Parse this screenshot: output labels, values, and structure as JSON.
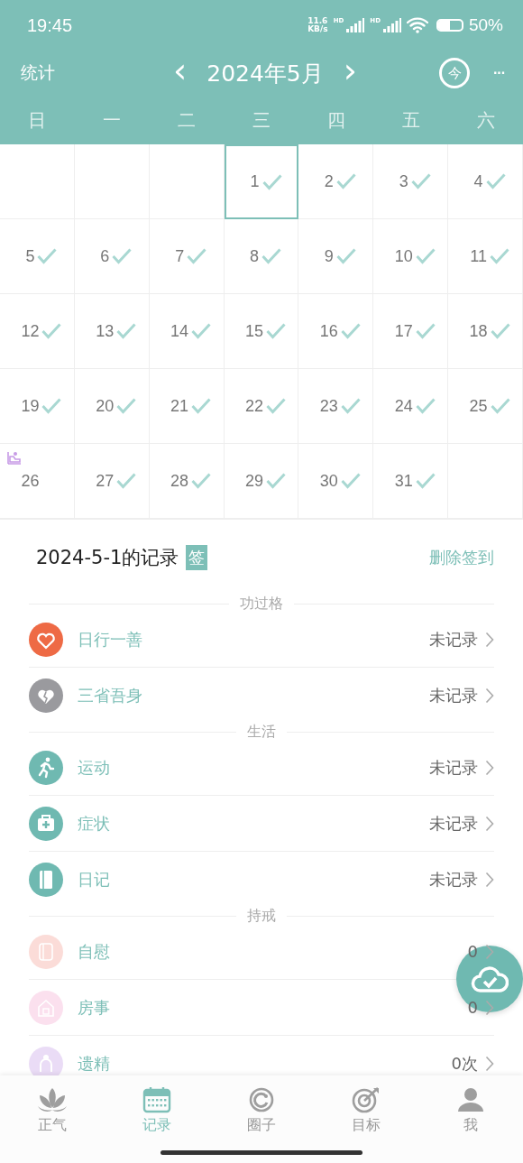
{
  "status_bar": {
    "time": "19:45",
    "net_speed": [
      "11.6",
      "KB/s"
    ],
    "signals": [
      {
        "label": "HD"
      },
      {
        "label": "HD"
      }
    ],
    "battery": {
      "level": 0.5,
      "text": "50%"
    }
  },
  "header": {
    "left": "统计",
    "prev": "‹",
    "title": "2024年5月",
    "next": "›",
    "today": "今",
    "more": "···"
  },
  "weekdays": [
    "日",
    "一",
    "二",
    "三",
    "四",
    "五",
    "六"
  ],
  "calendar": {
    "days": [
      {
        "day": "1",
        "checked": true,
        "selected": true,
        "badge": false
      },
      {
        "day": "2",
        "checked": true,
        "selected": false,
        "badge": false
      },
      {
        "day": "3",
        "checked": true,
        "selected": false,
        "badge": false
      },
      {
        "day": "4",
        "checked": true,
        "selected": false,
        "badge": false
      },
      {
        "day": "5",
        "checked": true,
        "selected": false,
        "badge": false
      },
      {
        "day": "6",
        "checked": true,
        "selected": false,
        "badge": false
      },
      {
        "day": "7",
        "checked": true,
        "selected": false,
        "badge": false
      },
      {
        "day": "8",
        "checked": true,
        "selected": false,
        "badge": false
      },
      {
        "day": "9",
        "checked": true,
        "selected": false,
        "badge": false
      },
      {
        "day": "10",
        "checked": true,
        "selected": false,
        "badge": false
      },
      {
        "day": "11",
        "checked": true,
        "selected": false,
        "badge": false
      },
      {
        "day": "12",
        "checked": true,
        "selected": false,
        "badge": false
      },
      {
        "day": "13",
        "checked": true,
        "selected": false,
        "badge": false
      },
      {
        "day": "14",
        "checked": true,
        "selected": false,
        "badge": false
      },
      {
        "day": "15",
        "checked": true,
        "selected": false,
        "badge": false
      },
      {
        "day": "16",
        "checked": true,
        "selected": false,
        "badge": false
      },
      {
        "day": "17",
        "checked": true,
        "selected": false,
        "badge": false
      },
      {
        "day": "18",
        "checked": true,
        "selected": false,
        "badge": false
      },
      {
        "day": "19",
        "checked": true,
        "selected": false,
        "badge": false
      },
      {
        "day": "20",
        "checked": true,
        "selected": false,
        "badge": false
      },
      {
        "day": "21",
        "checked": true,
        "selected": false,
        "badge": false
      },
      {
        "day": "22",
        "checked": true,
        "selected": false,
        "badge": false
      },
      {
        "day": "23",
        "checked": true,
        "selected": false,
        "badge": false
      },
      {
        "day": "24",
        "checked": true,
        "selected": false,
        "badge": false
      },
      {
        "day": "25",
        "checked": true,
        "selected": false,
        "badge": false
      },
      {
        "day": "26",
        "checked": false,
        "selected": false,
        "badge": true
      },
      {
        "day": "27",
        "checked": true,
        "selected": false,
        "badge": false
      },
      {
        "day": "28",
        "checked": true,
        "selected": false,
        "badge": false
      },
      {
        "day": "29",
        "checked": true,
        "selected": false,
        "badge": false
      },
      {
        "day": "30",
        "checked": true,
        "selected": false,
        "badge": false
      },
      {
        "day": "31",
        "checked": true,
        "selected": false,
        "badge": false
      }
    ]
  },
  "record": {
    "title": "2024-5-1的记录",
    "tag": "签",
    "action": "删除签到",
    "groups": [
      {
        "title": "功过格",
        "items": [
          {
            "kind": "heart",
            "name": "日行一善",
            "value": "未记录",
            "color": "#ee6a45"
          },
          {
            "kind": "broken-heart",
            "name": "三省吾身",
            "value": "未记录",
            "color": "#9a9a9e"
          }
        ]
      },
      {
        "title": "生活",
        "items": [
          {
            "kind": "runner",
            "name": "运动",
            "value": "未记录",
            "color": "#6fb9b1"
          },
          {
            "kind": "medkit",
            "name": "症状",
            "value": "未记录",
            "color": "#6fb9b1"
          },
          {
            "kind": "book",
            "name": "日记",
            "value": "未记录",
            "color": "#6fb9b1"
          }
        ]
      },
      {
        "title": "持戒",
        "items": [
          {
            "kind": "tissue",
            "name": "自慰",
            "value": "0",
            "color": "#fbdcd8"
          },
          {
            "kind": "house",
            "name": "房事",
            "value": "0",
            "color": "#fbe0ee"
          },
          {
            "kind": "person",
            "name": "遗精",
            "value": "0次",
            "color": "#eadcf6"
          }
        ]
      }
    ]
  },
  "tabs": [
    {
      "kind": "lotus",
      "label": "正气",
      "selected": false
    },
    {
      "kind": "calendar",
      "label": "记录",
      "selected": true
    },
    {
      "kind": "ring",
      "label": "圈子",
      "selected": false
    },
    {
      "kind": "target",
      "label": "目标",
      "selected": false
    },
    {
      "kind": "user",
      "label": "我",
      "selected": false
    }
  ]
}
